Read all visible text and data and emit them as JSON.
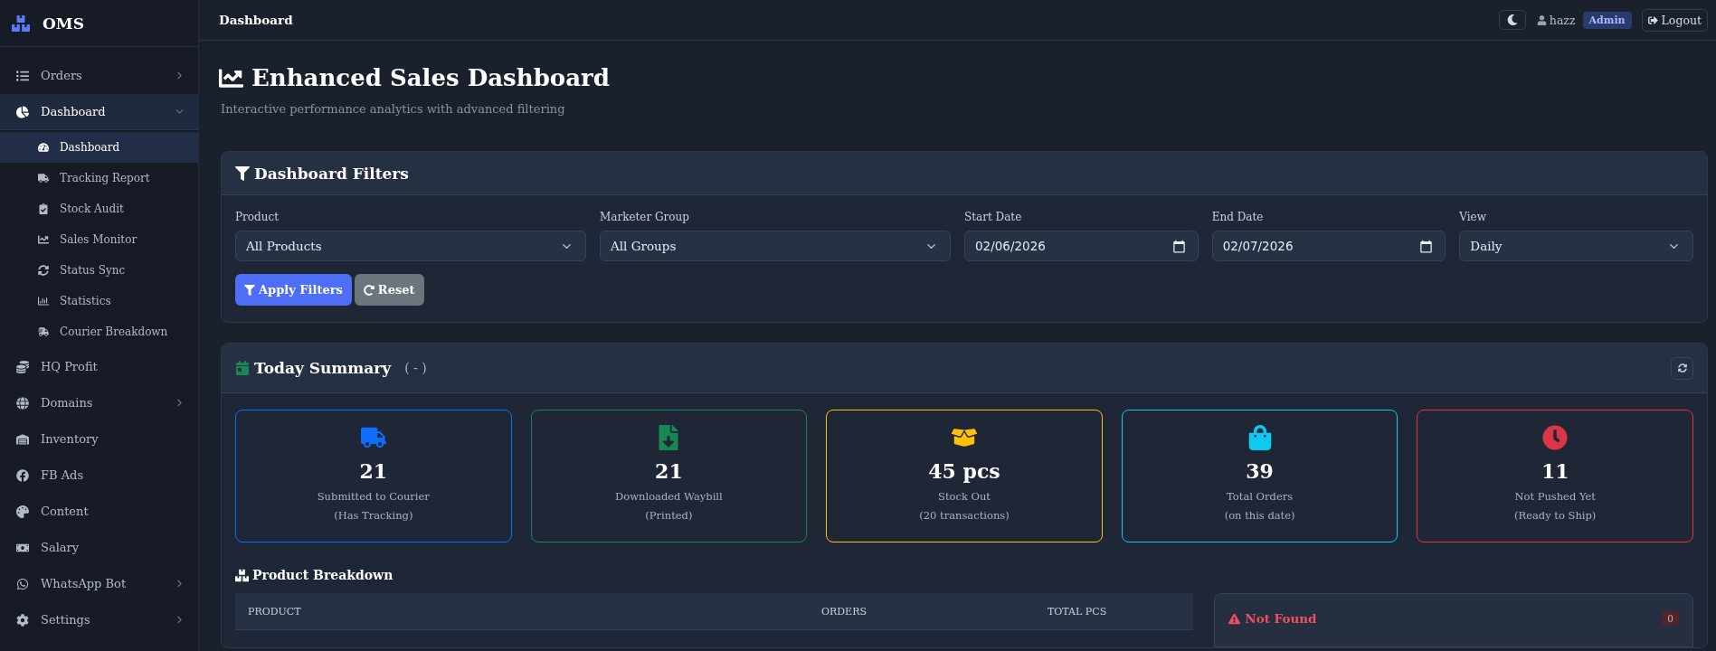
{
  "topbar": {
    "page_title": "Dashboard",
    "user": {
      "name": "hazz",
      "role": "Admin"
    },
    "logout": "Logout"
  },
  "sidebar": {
    "brand": "OMS",
    "items": [
      {
        "label": "Orders",
        "kind": "group",
        "expanded": false,
        "selected": false
      },
      {
        "label": "Dashboard",
        "kind": "group",
        "expanded": true,
        "selected": true,
        "children": [
          {
            "label": "Dashboard",
            "selected": true
          },
          {
            "label": "Tracking Report",
            "selected": false
          },
          {
            "label": "Stock Audit",
            "selected": false
          },
          {
            "label": "Sales Monitor",
            "selected": false
          },
          {
            "label": "Status Sync",
            "selected": false
          },
          {
            "label": "Statistics",
            "selected": false
          },
          {
            "label": "Courier Breakdown",
            "selected": false
          }
        ]
      },
      {
        "label": "HQ Profit",
        "kind": "link",
        "selected": false
      },
      {
        "label": "Domains",
        "kind": "group",
        "expanded": false,
        "selected": false
      },
      {
        "label": "Inventory",
        "kind": "link",
        "selected": false
      },
      {
        "label": "FB Ads",
        "kind": "link",
        "selected": false
      },
      {
        "label": "Content",
        "kind": "link",
        "selected": false
      },
      {
        "label": "Salary",
        "kind": "link",
        "selected": false
      },
      {
        "label": "WhatsApp Bot",
        "kind": "group",
        "expanded": false,
        "selected": false
      },
      {
        "label": "Settings",
        "kind": "group",
        "expanded": false,
        "selected": false
      }
    ]
  },
  "header": {
    "title": "Enhanced Sales Dashboard",
    "subtitle": "Interactive performance analytics with advanced filtering"
  },
  "filters": {
    "title": "Dashboard Filters",
    "fields": [
      {
        "label": "Product",
        "kind": "select",
        "value": "All Products"
      },
      {
        "label": "Marketer Group",
        "kind": "select",
        "value": "All Groups"
      },
      {
        "label": "Start Date",
        "kind": "date",
        "value": "02/06/2026"
      },
      {
        "label": "End Date",
        "kind": "date",
        "value": "02/07/2026"
      },
      {
        "label": "View",
        "kind": "select",
        "value": "Daily"
      }
    ],
    "buttons": [
      {
        "label": "Apply Filters",
        "kind": "primary"
      },
      {
        "label": "Reset",
        "kind": "secondary"
      }
    ]
  },
  "summary": {
    "title": "Today Summary",
    "date": "( - )",
    "cards": [
      {
        "value": "21",
        "label": "Submitted to Courier",
        "note": "(Has Tracking)",
        "color": "#0d6efd"
      },
      {
        "value": "21",
        "label": "Downloaded Waybill",
        "note": "(Printed)",
        "color": "#198754"
      },
      {
        "value": "45 pcs",
        "label": "Stock Out",
        "note": "(20 transactions)",
        "color": "#ffc107"
      },
      {
        "value": "39",
        "label": "Total Orders",
        "note": "(on this date)",
        "color": "#0dcaf0"
      },
      {
        "value": "11",
        "label": "Not Pushed Yet",
        "note": "(Ready to Ship)",
        "color": "#dc3545"
      }
    ]
  },
  "product_breakdown": {
    "title": "Product Breakdown",
    "columns": [
      "PRODUCT",
      "ORDERS",
      "TOTAL PCS"
    ]
  },
  "not_found": {
    "title": "Not Found",
    "count": "0"
  }
}
